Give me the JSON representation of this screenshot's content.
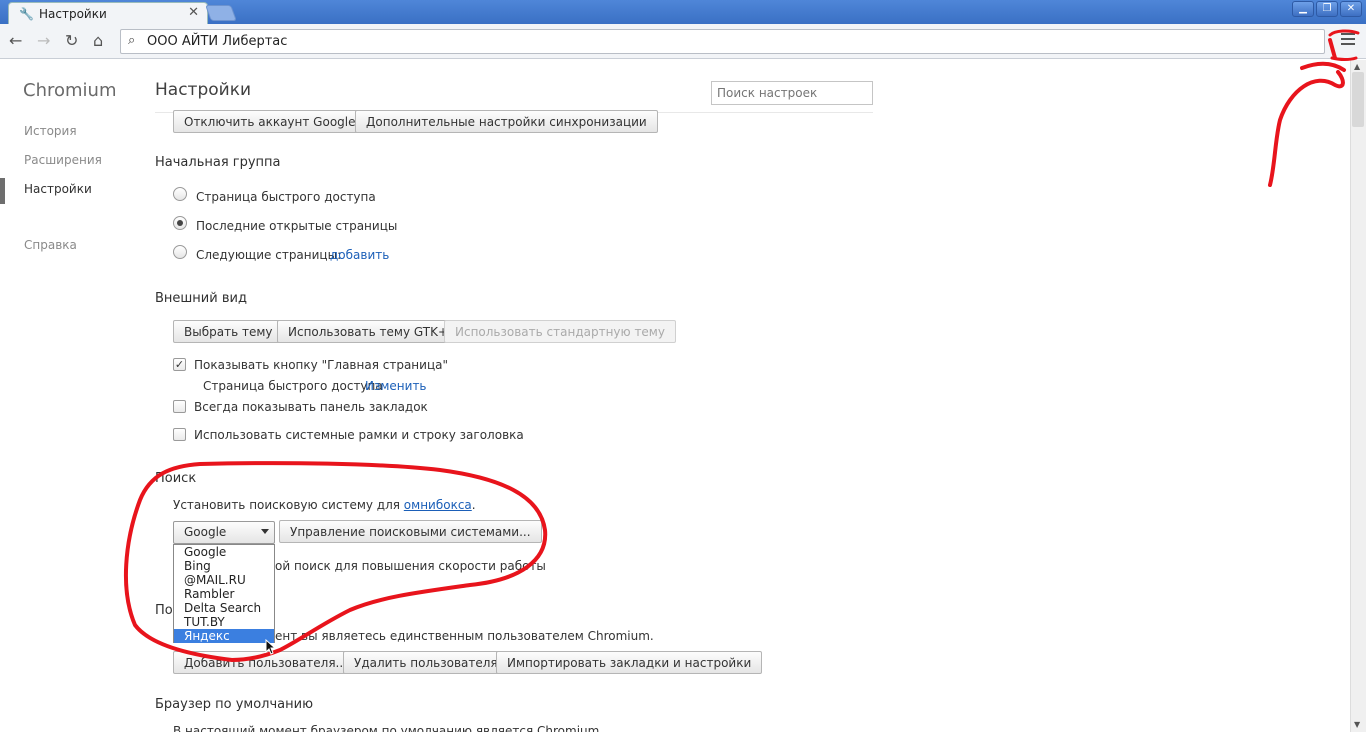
{
  "tab": {
    "title": "Настройки",
    "close": "✕"
  },
  "window_buttons": {
    "minimize": "▁",
    "restore": "❐",
    "close": "✕"
  },
  "toolbar": {
    "back": "←",
    "forward": "→",
    "reload": "↻",
    "home": "⌂",
    "address": "ООО АЙТИ Либертас"
  },
  "nav": {
    "brand": "Chromium",
    "items": [
      "История",
      "Расширения",
      "Настройки",
      "Справка"
    ]
  },
  "page": {
    "title": "Настройки",
    "search_placeholder": "Поиск настроек"
  },
  "sync": {
    "disconnect": "Отключить аккаунт Google...",
    "advanced": "Дополнительные настройки синхронизации"
  },
  "startup": {
    "title": "Начальная группа",
    "options": [
      "Страница быстрого доступа",
      "Последние открытые страницы",
      "Следующие страницы:"
    ],
    "add_link": "добавить"
  },
  "appearance": {
    "title": "Внешний вид",
    "choose_theme": "Выбрать тему",
    "gtk_theme": "Использовать тему GTK+",
    "default_theme": "Использовать стандартную тему",
    "show_home": "Показывать кнопку \"Главная страница\"",
    "home_page": "Страница быстрого доступа",
    "change": "Изменить",
    "bookmarks_bar": "Всегда показывать панель закладок",
    "system_frames": "Использовать системные рамки и строку заголовка"
  },
  "search": {
    "title": "Поиск",
    "desc_prefix": "Установить поисковую систему для ",
    "desc_link": "омнибокса",
    "desc_suffix": ".",
    "selected": "Google",
    "manage": "Управление поисковыми системами...",
    "instant_partial": "ой поиск для повышения скорости работы",
    "options": [
      "Google",
      "Bing",
      "@MAIL.RU",
      "Rambler",
      "Delta Search",
      "TUT.BY",
      "Яндекс"
    ]
  },
  "users": {
    "title_partial": "По",
    "desc_partial": "ент вы являетесь единственным пользователем Chromium.",
    "add": "Добавить пользователя...",
    "remove": "Удалить пользователя",
    "import": "Импортировать закладки и настройки"
  },
  "default_browser": {
    "title": "Браузер по умолчанию",
    "desc": "В настоящий момент браузером по умолчанию является Chromium."
  },
  "colors": {
    "annotation": "#e8141c",
    "accent": "#3b7fe0",
    "link": "#1b5fb8"
  }
}
